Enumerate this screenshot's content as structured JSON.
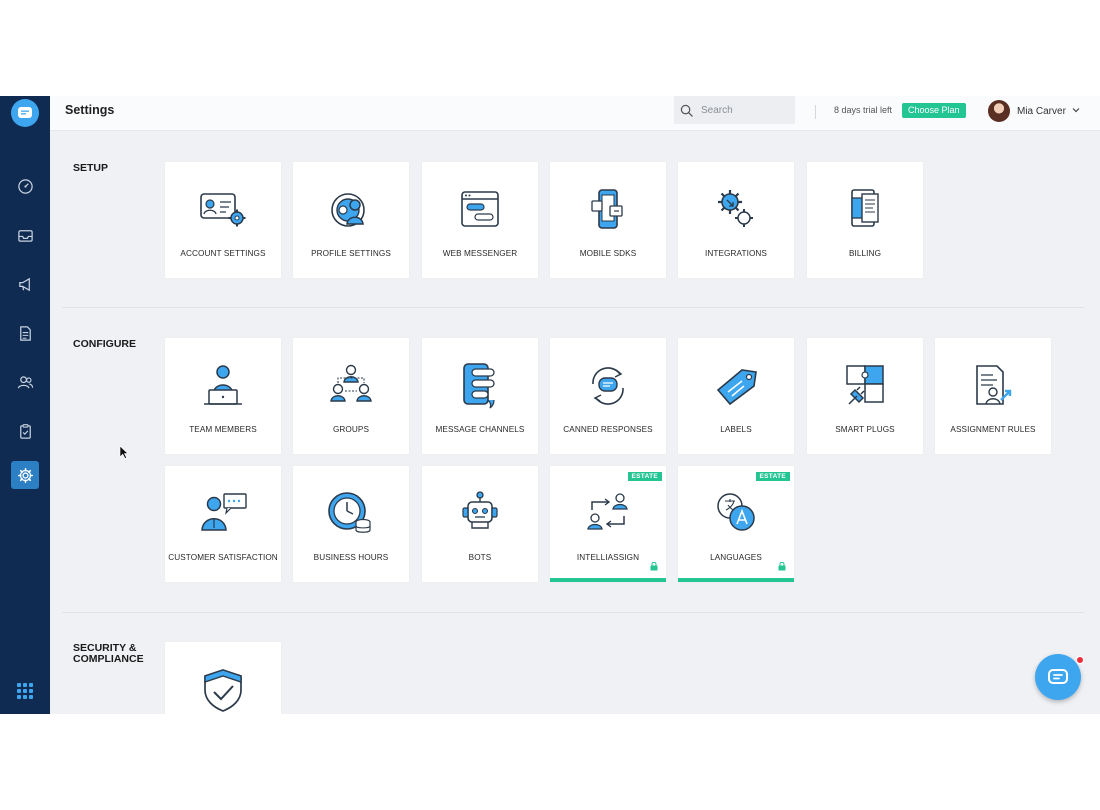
{
  "header": {
    "title": "Settings",
    "search_placeholder": "Search",
    "trial_text": "8 days trial left",
    "plan_button": "Choose Plan",
    "user_name": "Mia Carver"
  },
  "sidebar": {
    "items": [
      {
        "icon": "dashboard-icon"
      },
      {
        "icon": "inbox-icon"
      },
      {
        "icon": "megaphone-icon"
      },
      {
        "icon": "document-icon"
      },
      {
        "icon": "contacts-icon"
      },
      {
        "icon": "clipboard-icon"
      },
      {
        "icon": "settings-gear-icon",
        "active": true
      }
    ]
  },
  "sections": {
    "setup": {
      "title": "SETUP",
      "cards": [
        {
          "label": "ACCOUNT SETTINGS"
        },
        {
          "label": "PROFILE SETTINGS"
        },
        {
          "label": "WEB MESSENGER"
        },
        {
          "label": "MOBILE SDKS"
        },
        {
          "label": "INTEGRATIONS"
        },
        {
          "label": "BILLING"
        }
      ]
    },
    "configure": {
      "title": "CONFIGURE",
      "cards": [
        {
          "label": "TEAM MEMBERS"
        },
        {
          "label": "GROUPS"
        },
        {
          "label": "MESSAGE CHANNELS"
        },
        {
          "label": "CANNED RESPONSES"
        },
        {
          "label": "LABELS"
        },
        {
          "label": "SMART PLUGS"
        },
        {
          "label": "ASSIGNMENT RULES"
        },
        {
          "label": "CUSTOMER SATISFACTION"
        },
        {
          "label": "BUSINESS HOURS"
        },
        {
          "label": "BOTS"
        },
        {
          "label": "INTELLIASSIGN",
          "badge": "ESTATE",
          "locked": true
        },
        {
          "label": "LANGUAGES",
          "badge": "ESTATE",
          "locked": true
        }
      ]
    },
    "security": {
      "title_line1": "SECURITY &",
      "title_line2": "COMPLIANCE"
    }
  },
  "colors": {
    "sidebar": "#0f2b52",
    "accent_blue": "#3ea6ef",
    "accent_green": "#23c592",
    "background": "#eff1f4"
  }
}
